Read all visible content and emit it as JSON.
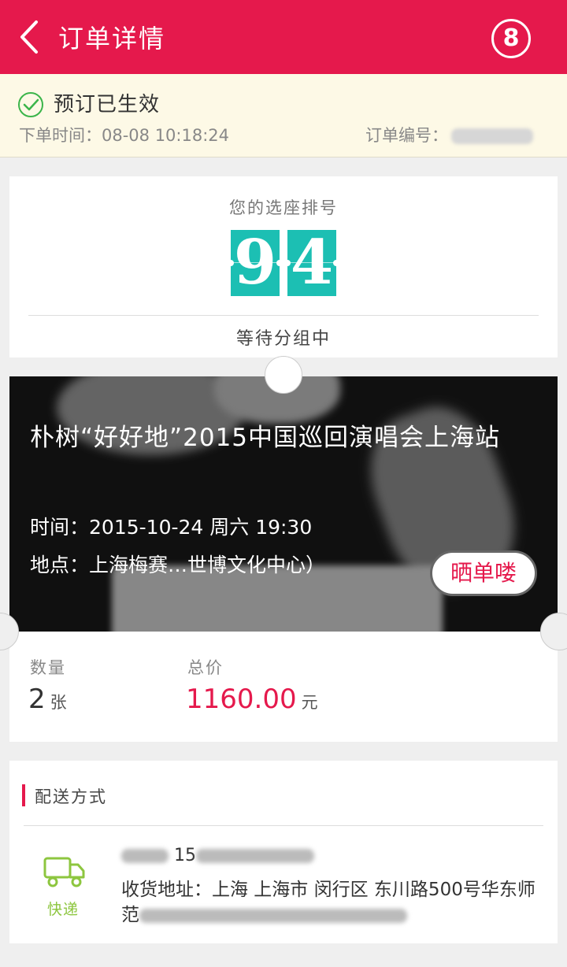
{
  "header": {
    "title": "订单详情",
    "badge": "8",
    "accent_color": "#e5194c",
    "back_icon": "chevron-left-icon"
  },
  "status": {
    "icon": "check-circle-icon",
    "text": "预订已生效",
    "order_time_label": "下单时间：",
    "order_time_value": "08-08 10:18:24",
    "order_no_label": "订单编号："
  },
  "seat": {
    "label": "您的选座排号",
    "digits": [
      "9",
      "4"
    ],
    "status": "等待分组中",
    "digit_color": "#1cbfb3"
  },
  "event": {
    "title": "朴树“好好地”2015中国巡回演唱会上海站",
    "time_label": "时间：",
    "time_value": "2015-10-24 周六 19:30",
    "venue_label": "地点：",
    "venue_value": "上海梅赛…世博文化中心）",
    "share_button": "晒单喽",
    "quantity_label": "数量",
    "quantity_value": "2",
    "quantity_unit": "张",
    "total_label": "总价",
    "total_value": "1160.00",
    "total_unit": "元"
  },
  "delivery": {
    "title": "配送方式",
    "method_icon": "truck-icon",
    "method_label": "快递",
    "phone_prefix": "15",
    "address_label": "收货地址：",
    "address_value": "上海 上海市 闵行区 东川路500号华东师范",
    "method_color": "#8dc63f"
  }
}
